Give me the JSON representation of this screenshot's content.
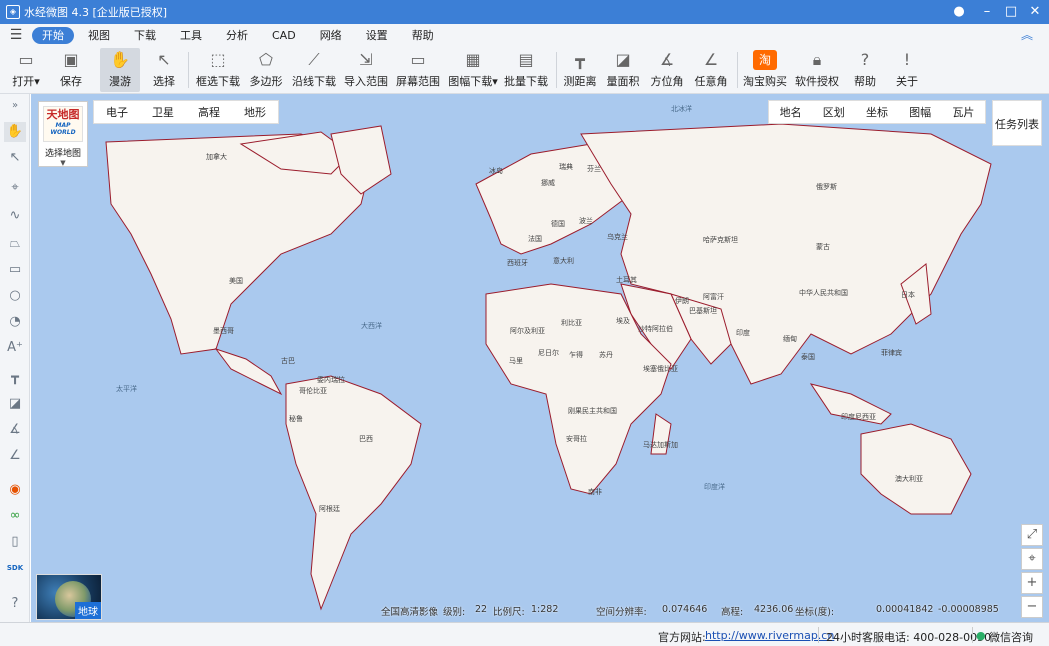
{
  "titlebar": {
    "title": "水经微图 4.3 [企业版已授权]"
  },
  "menu": [
    "开始",
    "视图",
    "下载",
    "工具",
    "分析",
    "CAD",
    "网络",
    "设置",
    "帮助"
  ],
  "ribbon": [
    "打开",
    "保存",
    "漫游",
    "选择",
    "框选下载",
    "多边形",
    "沿线下载",
    "导入范围",
    "屏幕范围",
    "图幅下载",
    "批量下载",
    "测距离",
    "量面积",
    "方位角",
    "任意角",
    "淘宝购买",
    "软件授权",
    "帮助",
    "关于"
  ],
  "map": {
    "logo_label": "选择地图",
    "types": [
      "电子",
      "卫星",
      "高程",
      "地形"
    ],
    "overlays": [
      "地名",
      "区划",
      "坐标",
      "图幅",
      "瓦片"
    ],
    "task_list": "任务列表",
    "earth_label": "地球",
    "places": [
      "加拿大",
      "美国",
      "墨西哥",
      "古巴",
      "委内瑞拉",
      "哥伦比亚",
      "秘鲁",
      "巴西",
      "阿根廷",
      "冰岛",
      "挪威",
      "瑞典",
      "芬兰",
      "德国",
      "法国",
      "西班牙",
      "意大利",
      "波兰",
      "乌克兰",
      "俄罗斯",
      "哈萨克斯坦",
      "蒙古",
      "中华人民共和国",
      "日本",
      "阿尔及利亚",
      "利比亚",
      "埃及",
      "马里",
      "尼日尔",
      "乍得",
      "苏丹",
      "埃塞俄比亚",
      "刚果民主共和国",
      "安哥拉",
      "南非",
      "土耳其",
      "伊朗",
      "沙特阿拉伯",
      "阿富汗",
      "巴基斯坦",
      "印度",
      "缅甸",
      "泰国",
      "印度尼西亚",
      "菲律宾",
      "马达加斯加",
      "澳大利亚"
    ],
    "oceans": [
      "大西洋",
      "太平洋",
      "印度洋",
      "北冰洋"
    ]
  },
  "info": {
    "image_source": "全国高清影像",
    "level_label": "级别:",
    "level": "22",
    "scale_label": "比例尺:",
    "scale": "1:282",
    "resolution_label": "空间分辨率:",
    "resolution": "0.074646",
    "elevation_label": "高程:",
    "elevation": "4236.06",
    "units_label": "坐标(度):",
    "lon": "0.00041842",
    "lat": "-0.00008985"
  },
  "status": {
    "site_label": "官方网站:",
    "site_url": "http://www.rivermap.cn",
    "hotline": "24小时客服电话: 400-028-0050",
    "wechat": "微信咨询"
  }
}
